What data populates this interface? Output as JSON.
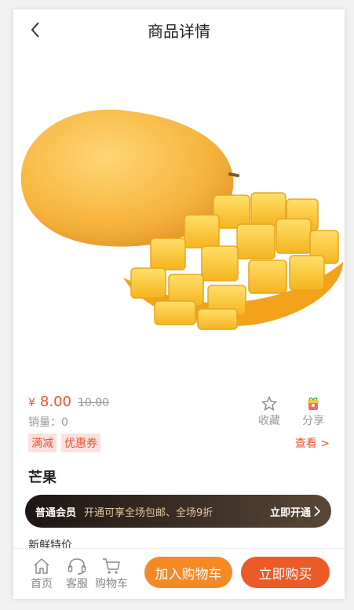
{
  "header": {
    "title": "商品详情"
  },
  "product": {
    "currency": "¥",
    "price": "8.00",
    "old_price": "10.00",
    "sales": "销量：0",
    "name": "芒果",
    "tags": [
      "满减",
      "优惠券"
    ],
    "view_label": "查看 >",
    "subtitle": "新鲜特价"
  },
  "actions": {
    "favorite": "收藏",
    "share": "分享"
  },
  "vip": {
    "title": "普通会员",
    "desc": "开通可享全场包邮、全场9折",
    "button": "立即开通"
  },
  "bottom_nav": {
    "home": "首页",
    "service": "客服",
    "cart": "购物车"
  },
  "buttons": {
    "add_cart": "加入购物车",
    "buy_now": "立即购买"
  },
  "colors": {
    "accent": "#e8552e",
    "cart_button": "#f38a25",
    "buy_button": "#ec5a28",
    "vip_text": "#e8c9a2"
  }
}
